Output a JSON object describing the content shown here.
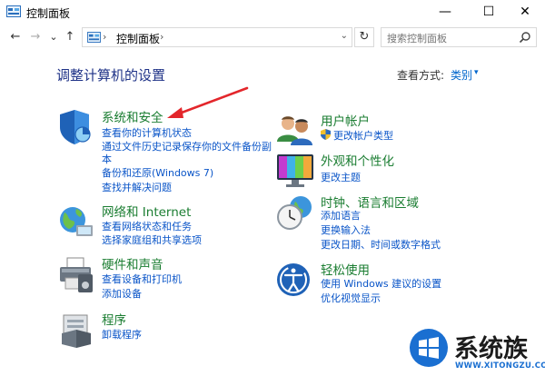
{
  "window": {
    "title": "控制面板",
    "minimize": "—",
    "maximize": "☐",
    "close": "✕"
  },
  "nav": {
    "back": "←",
    "forward": "→",
    "recent": "⌄",
    "up": "↑"
  },
  "address": {
    "chevron": "›",
    "path": "控制面板",
    "chevron2": "›",
    "dropdown": "⌄",
    "refresh": "↻"
  },
  "search": {
    "placeholder": "搜索控制面板"
  },
  "page": {
    "heading": "调整计算机的设置",
    "view_by_label": "查看方式:",
    "view_by_value": "类别",
    "view_by_arrow": "▾"
  },
  "categories": {
    "system": {
      "title": "系统和安全",
      "links": [
        "查看你的计算机状态",
        "通过文件历史记录保存你的文件备份副",
        "本",
        "备份和还原(Windows 7)",
        "查找并解决问题"
      ]
    },
    "network": {
      "title": "网络和 Internet",
      "links": [
        "查看网络状态和任务",
        "选择家庭组和共享选项"
      ]
    },
    "hardware": {
      "title": "硬件和声音",
      "links": [
        "查看设备和打印机",
        "添加设备"
      ]
    },
    "programs": {
      "title": "程序",
      "links": [
        "卸载程序"
      ]
    },
    "users": {
      "title": "用户帐户",
      "links": [
        "更改帐户类型"
      ]
    },
    "appearance": {
      "title": "外观和个性化",
      "links": [
        "更改主题"
      ]
    },
    "clock": {
      "title": "时钟、语言和区域",
      "links": [
        "添加语言",
        "更换输入法",
        "更改日期、时间或数字格式"
      ]
    },
    "ease": {
      "title": "轻松使用",
      "links": [
        "使用 Windows 建议的设置",
        "优化视觉显示"
      ]
    }
  },
  "watermark": {
    "brand": "系统族",
    "url": "WWW.XITONGZU.COM"
  }
}
